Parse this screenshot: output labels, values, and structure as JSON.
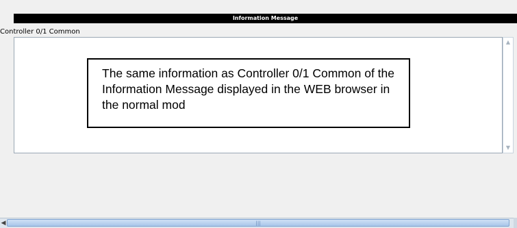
{
  "window": {
    "title": "Information Message"
  },
  "section": {
    "label": "Controller 0/1 Common"
  },
  "note": {
    "text": "The same information as Controller 0/1 Common of the Information Message displayed in the WEB browser in the normal mod"
  },
  "scrollbars": {
    "vertical": {
      "up_icon": "chevron-up-icon",
      "down_icon": "chevron-down-icon"
    },
    "horizontal": {
      "left_icon": "chevron-left-icon",
      "grip_icon": "grip-icon"
    }
  }
}
